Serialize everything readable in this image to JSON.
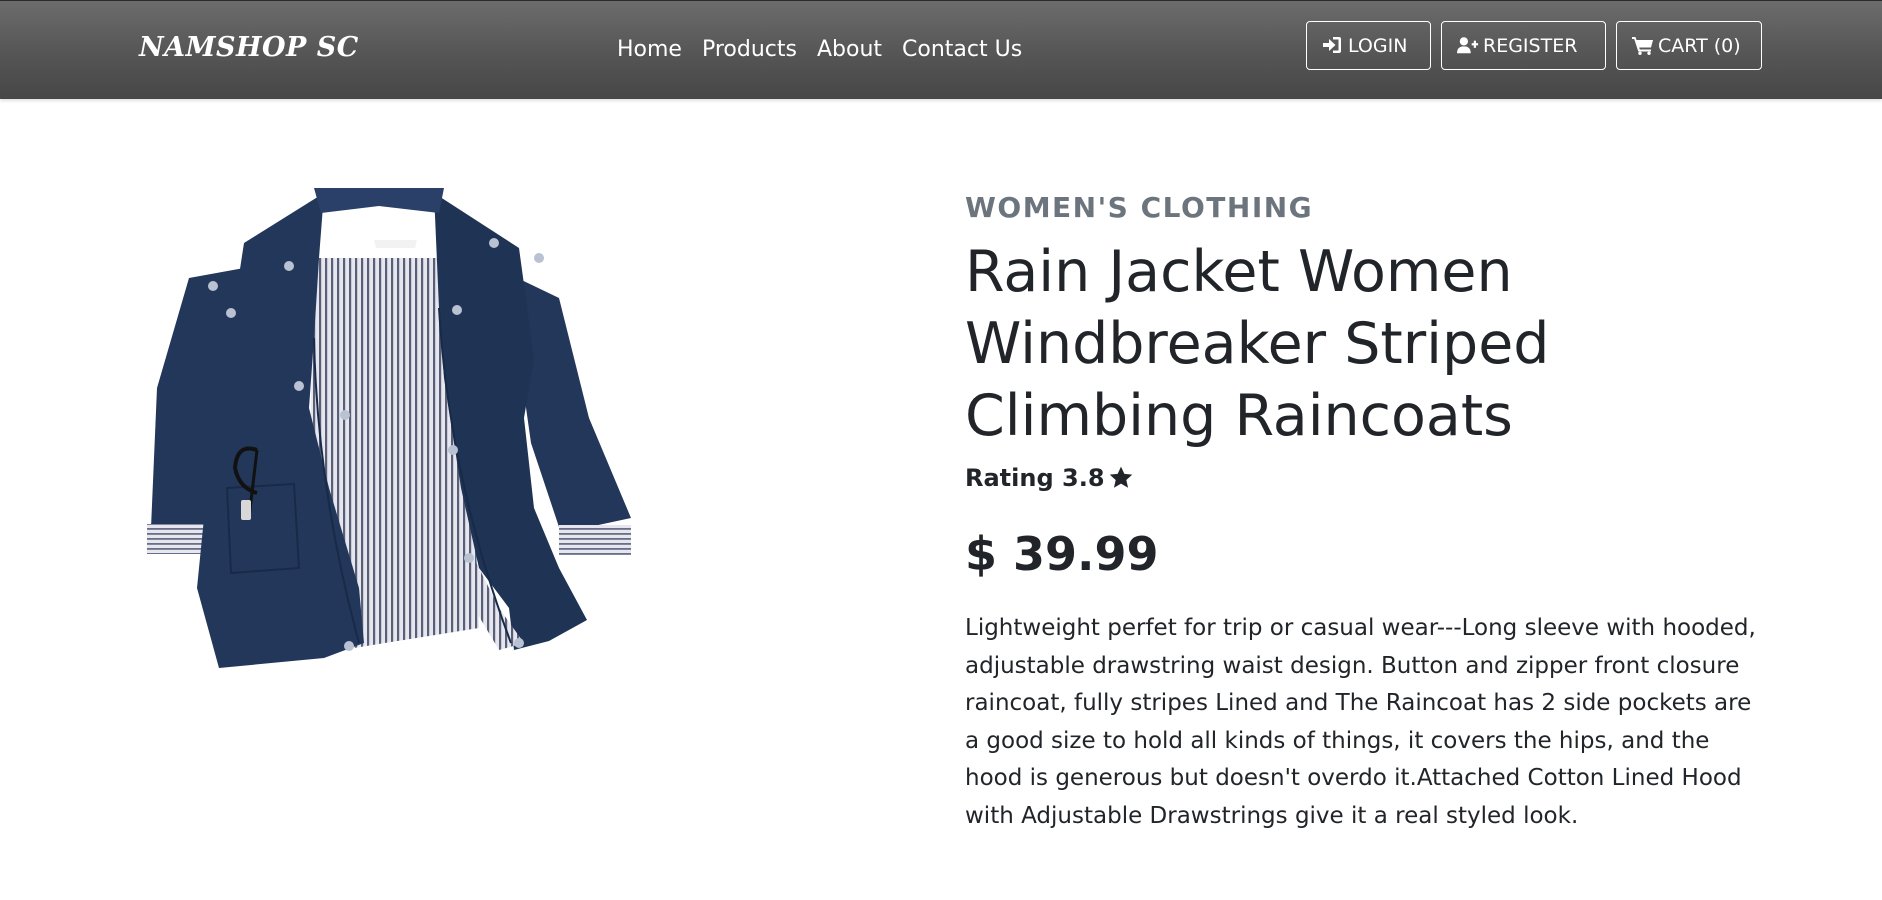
{
  "navbar": {
    "brand": "NAMSHOP SC",
    "links": [
      "Home",
      "Products",
      "About",
      "Contact Us"
    ],
    "login_label": "LOGIN",
    "register_label": "REGISTER",
    "cart_label": "CART (0)"
  },
  "product": {
    "category": "WOMEN'S CLOTHING",
    "title": "Rain Jacket Women Windbreaker Striped Climbing Raincoats",
    "rating_text": "Rating 3.8",
    "rating_icon": "star-icon",
    "price": "$ 39.99",
    "description": "Lightweight perfet for trip or casual wear---Long sleeve with hooded, adjustable drawstring waist design. Button and zipper front closure raincoat, fully stripes Lined and The Raincoat has 2 side pockets are a good size to hold all kinds of things, it covers the hips, and the hood is generous but doesn't overdo it.Attached Cotton Lined Hood with Adjustable Drawstrings give it a real styled look.",
    "image_subject": "navy rain jacket with striped lining"
  },
  "colors": {
    "navbar_top": "#6c6c6c",
    "navbar_bottom": "#474747",
    "jacket_navy": "#22375a",
    "category_gray": "#6c757d",
    "text_dark": "#212529"
  }
}
